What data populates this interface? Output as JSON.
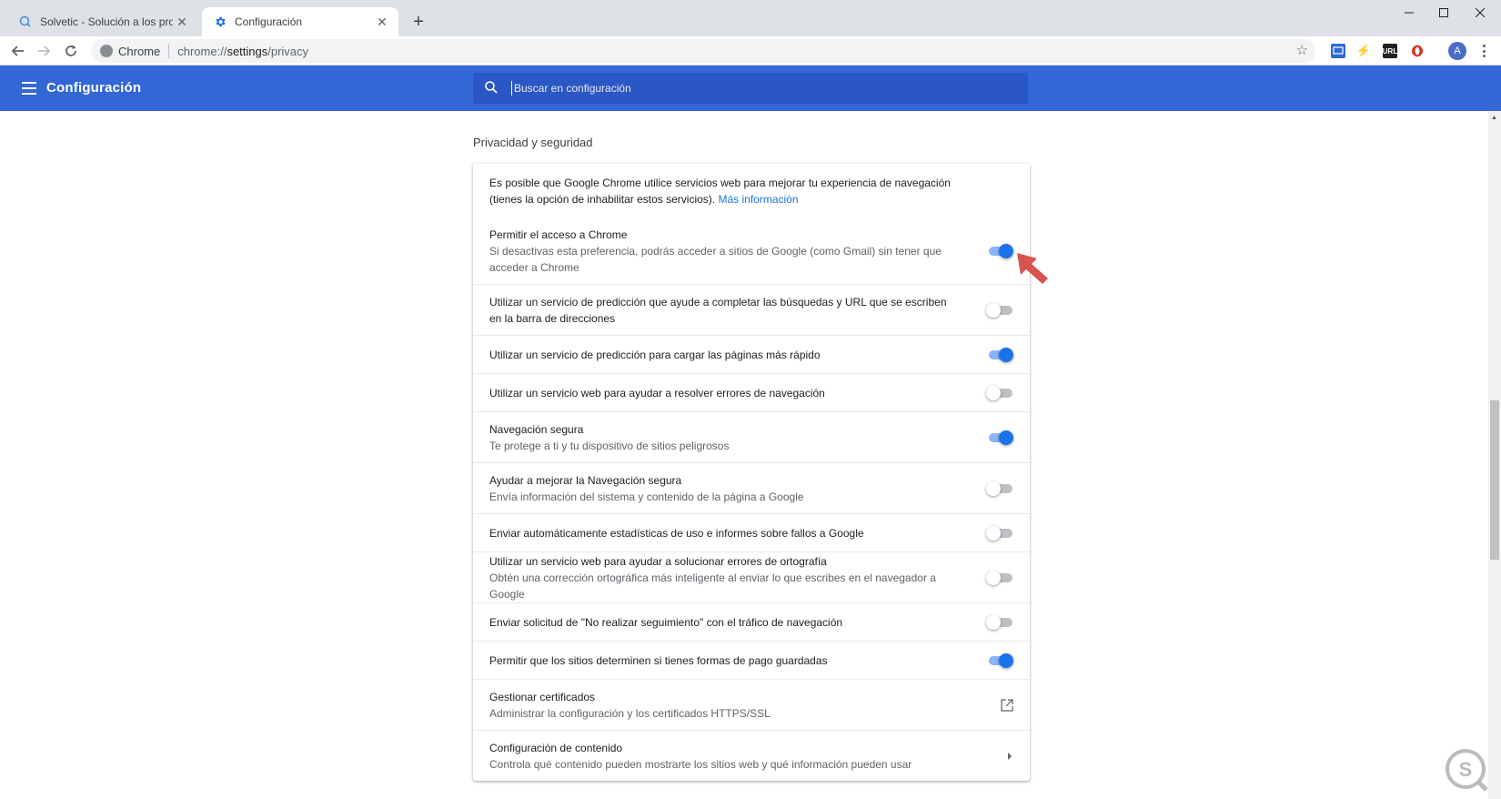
{
  "browser": {
    "tabs": [
      {
        "title": "Solvetic - Solución a los problem",
        "active": false
      },
      {
        "title": "Configuración",
        "active": true
      }
    ],
    "new_tab_symbol": "+",
    "close_symbol": "✕",
    "window_controls": {
      "minimize": "—",
      "maximize": "☐",
      "close": "✕"
    },
    "omnibox": {
      "site_label": "Chrome",
      "url_prefix": "chrome://",
      "url_host": "settings",
      "url_path": "/privacy"
    },
    "extensions": [
      {
        "name": "extension-1-icon",
        "color": "#2a6bd6"
      },
      {
        "name": "extension-2-icon",
        "color": "#9aa0a6"
      },
      {
        "name": "url-extension-icon",
        "color": "#202124",
        "label": "URL"
      },
      {
        "name": "opera-icon",
        "color": "#d93025"
      }
    ],
    "avatar_letter": "A"
  },
  "header": {
    "title": "Configuración",
    "search_placeholder": "Buscar en configuración",
    "bg_color": "#3367d6"
  },
  "section": {
    "title": "Privacidad y seguridad",
    "intro": {
      "text": "Es posible que Google Chrome utilice servicios web para mejorar tu experiencia de navegación (tienes la opción de inhabilitar estos servicios).",
      "link": "Más información"
    },
    "rows": [
      {
        "title": "Permitir el acceso a Chrome",
        "subtitle": "Si desactivas esta preferencia, podrás acceder a sitios de Google (como Gmail) sin tener que acceder a Chrome",
        "control": "toggle",
        "on": true
      },
      {
        "title": "Utilizar un servicio de predicción que ayude a completar las búsquedas y URL que se escriben en la barra de direcciones",
        "subtitle": "",
        "control": "toggle",
        "on": false
      },
      {
        "title": "Utilizar un servicio de predicción para cargar las páginas más rápido",
        "subtitle": "",
        "control": "toggle",
        "on": true
      },
      {
        "title": "Utilizar un servicio web para ayudar a resolver errores de navegación",
        "subtitle": "",
        "control": "toggle",
        "on": false
      },
      {
        "title": "Navegación segura",
        "subtitle": "Te protege a ti y tu dispositivo de sitios peligrosos",
        "control": "toggle",
        "on": true
      },
      {
        "title": "Ayudar a mejorar la Navegación segura",
        "subtitle": "Envía información del sistema y contenido de la página a Google",
        "control": "toggle",
        "on": false
      },
      {
        "title": "Enviar automáticamente estadísticas de uso e informes sobre fallos a Google",
        "subtitle": "",
        "control": "toggle",
        "on": false
      },
      {
        "title": "Utilizar un servicio web para ayudar a solucionar errores de ortografía",
        "subtitle": "Obtén una corrección ortográfica más inteligente al enviar lo que escribes en el navegador a Google",
        "control": "toggle",
        "on": false
      },
      {
        "title": "Enviar solicitud de \"No realizar seguimiento\" con el tráfico de navegación",
        "subtitle": "",
        "control": "toggle",
        "on": false
      },
      {
        "title": "Permitir que los sitios determinen si tienes formas de pago guardadas",
        "subtitle": "",
        "control": "toggle",
        "on": true
      },
      {
        "title": "Gestionar certificados",
        "subtitle": "Administrar la configuración y los certificados HTTPS/SSL",
        "control": "external",
        "on": null
      },
      {
        "title": "Configuración de contenido",
        "subtitle": "Controla qué contenido pueden mostrarte los sitios web y qué información pueden usar",
        "control": "arrow",
        "on": null
      }
    ]
  },
  "colors": {
    "accent": "#1a73e8",
    "annotation_arrow": "#d9534f"
  }
}
